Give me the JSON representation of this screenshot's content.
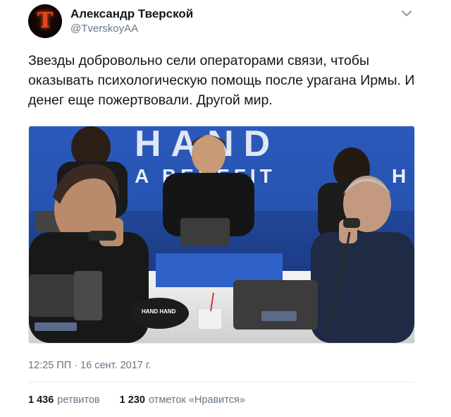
{
  "author": {
    "display_name": "Александр Тверской",
    "handle": "@TverskoyAA",
    "avatar_icon": "red-t-logo"
  },
  "menu": {
    "icon": "chevron-down-icon",
    "color": "#657786"
  },
  "tweet": {
    "text_lines": [
      "Звезды добровольно сели операторами связи, чтобы",
      "оказывать психологическую помощь после урагана Ирмы. И",
      "денег еще пожертвовали. Другой мир."
    ]
  },
  "media": {
    "banner_text_top": "HAND",
    "banner_text_bottom": "A BENEFIT",
    "banner_fragment": "H",
    "cap_text": "HAND HAND"
  },
  "timestamp": "12:25 ПП · 16 сент. 2017 г.",
  "stats": {
    "retweets_count": "1 436",
    "retweets_label": "ретвитов",
    "likes_count": "1 230",
    "likes_label": "отметок «Нравится»"
  },
  "colors": {
    "text_primary": "#14171a",
    "text_secondary": "#657786",
    "divider": "#e6ecf0",
    "banner_blue": "#1f4fa8"
  }
}
